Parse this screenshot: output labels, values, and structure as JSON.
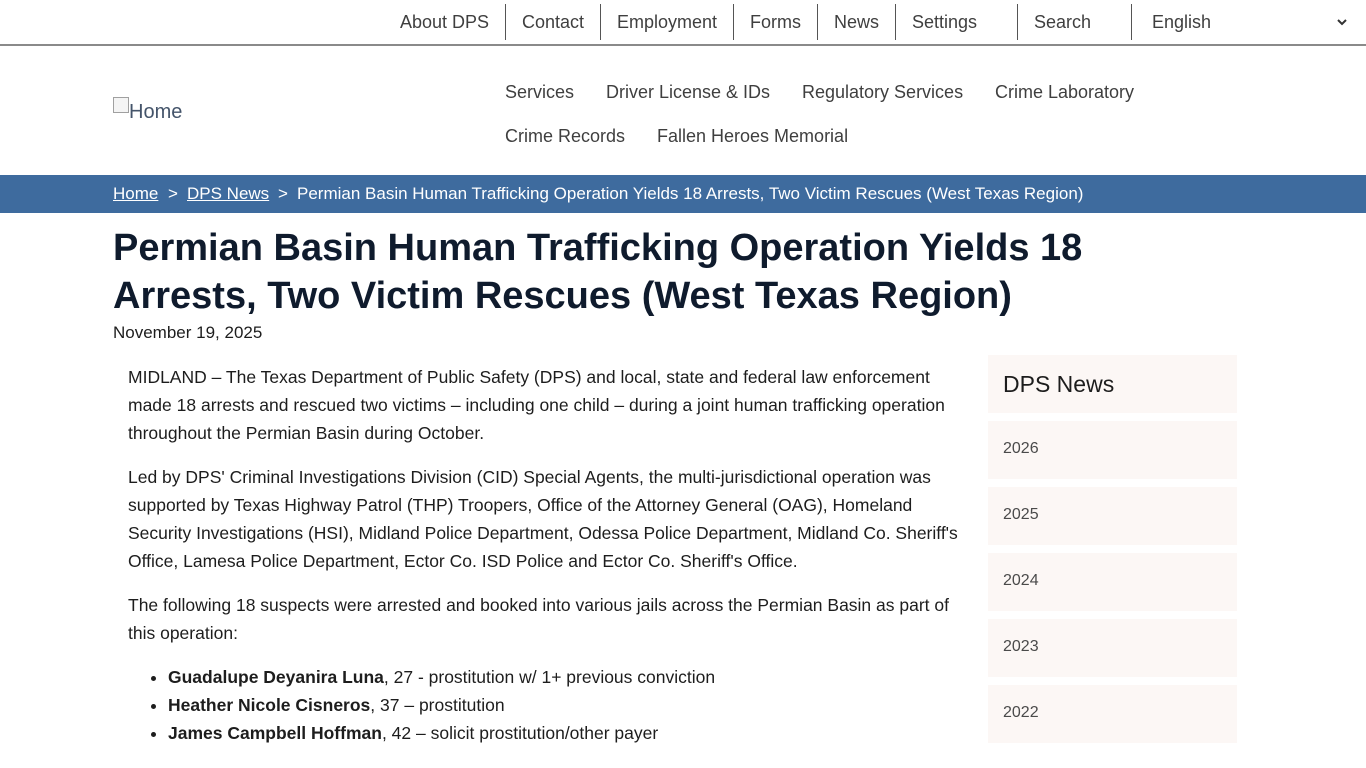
{
  "utility_nav": {
    "about": "About DPS",
    "contact": "Contact",
    "employment": "Employment",
    "forms": "Forms",
    "news": "News",
    "settings": "Settings",
    "search": "Search",
    "language": "English"
  },
  "header": {
    "logo_alt": "Home",
    "main_nav": [
      "Services",
      "Driver License & IDs",
      "Regulatory Services",
      "Crime Laboratory",
      "Crime Records",
      "Fallen Heroes Memorial"
    ]
  },
  "breadcrumb": {
    "home": "Home",
    "sep": ">",
    "section": "DPS News",
    "current": "Permian Basin Human Trafficking Operation Yields 18 Arrests, Two Victim Rescues (West Texas Region)"
  },
  "article": {
    "title": "Permian Basin Human Trafficking Operation Yields 18 Arrests, Two Victim Rescues (West Texas Region)",
    "date": "November 19, 2025",
    "paragraphs": [
      "MIDLAND – The Texas Department of Public Safety (DPS) and local, state and federal law enforcement made 18 arrests and rescued two victims – including one child – during a joint human trafficking operation throughout the Permian Basin during October.",
      "Led by DPS' Criminal Investigations Division (CID) Special Agents, the multi-jurisdictional operation was supported by Texas Highway Patrol (THP) Troopers, Office of the Attorney General (OAG), Homeland Security Investigations (HSI), Midland Police Department, Odessa Police Department, Midland Co. Sheriff's Office, Lamesa Police Department, Ector Co. ISD Police and Ector Co. Sheriff's Office.",
      "The following 18 suspects were arrested and booked into various jails across the Permian Basin as part of this operation:"
    ],
    "suspects": [
      {
        "name": "Guadalupe Deyanira Luna",
        "detail": ", 27 - prostitution w/ 1+ previous conviction"
      },
      {
        "name": "Heather Nicole Cisneros",
        "detail": ", 37 – prostitution"
      },
      {
        "name": "James Campbell Hoffman",
        "detail": ", 42 – solicit prostitution/other payer"
      }
    ]
  },
  "sidebar": {
    "heading": "DPS News",
    "years": [
      "2026",
      "2025",
      "2024",
      "2023",
      "2022"
    ]
  }
}
